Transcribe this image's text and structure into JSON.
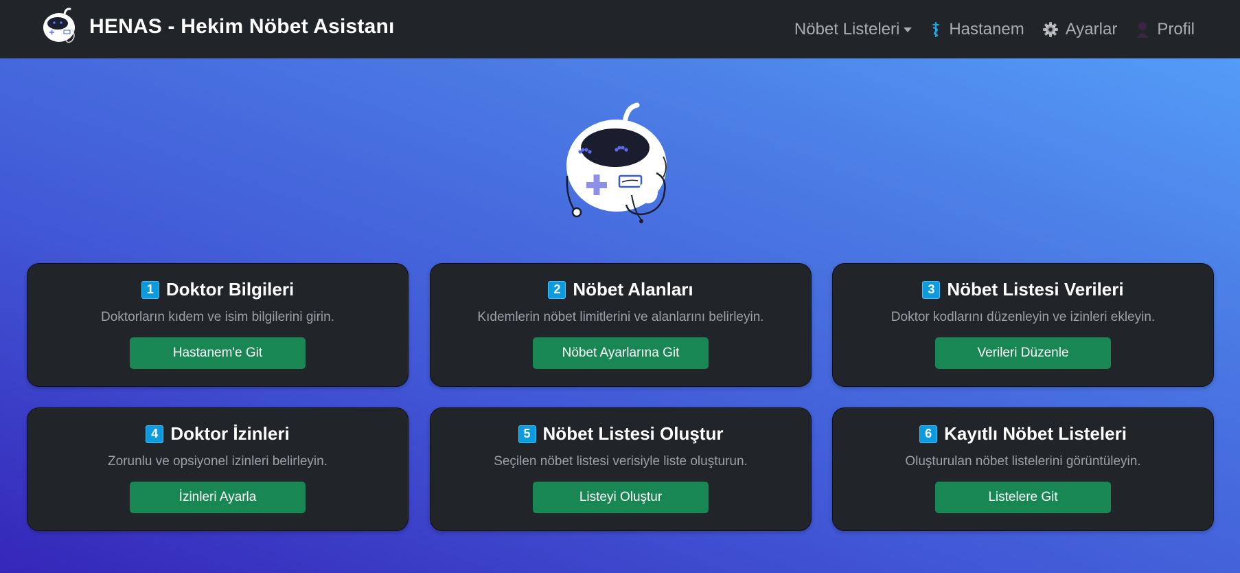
{
  "navbar": {
    "brand": "HENAS - Hekim Nöbet Asistanı",
    "items": [
      {
        "label": "Nöbet Listeleri",
        "icon": "caret-down-icon"
      },
      {
        "label": "Hastanem",
        "icon": "caduceus-icon"
      },
      {
        "label": "Ayarlar",
        "icon": "gear-icon"
      },
      {
        "label": "Profil",
        "icon": "user-icon"
      }
    ]
  },
  "cards": [
    {
      "number": "1",
      "title": "Doktor Bilgileri",
      "description": "Doktorların kıdem ve isim bilgilerini girin.",
      "button": "Hastanem'e Git"
    },
    {
      "number": "2",
      "title": "Nöbet Alanları",
      "description": "Kıdemlerin nöbet limitlerini ve alanlarını belirleyin.",
      "button": "Nöbet Ayarlarına Git"
    },
    {
      "number": "3",
      "title": "Nöbet Listesi Verileri",
      "description": "Doktor kodlarını düzenleyin ve izinleri ekleyin.",
      "button": "Verileri Düzenle"
    },
    {
      "number": "4",
      "title": "Doktor İzinleri",
      "description": "Zorunlu ve opsiyonel izinleri belirleyin.",
      "button": "İzinleri Ayarla"
    },
    {
      "number": "5",
      "title": "Nöbet Listesi Oluştur",
      "description": "Seçilen nöbet listesi verisiyle liste oluşturun.",
      "button": "Listeyi Oluştur"
    },
    {
      "number": "6",
      "title": "Kayıtlı Nöbet Listeleri",
      "description": "Oluşturulan nöbet listelerini görüntüleyin.",
      "button": "Listelere Git"
    }
  ],
  "colors": {
    "navbar": "#212529",
    "card": "#212529",
    "button": "#198754",
    "badge": "#0d9be0",
    "bg_light": "#55a3fb",
    "bg_dark": "#3526b9"
  }
}
